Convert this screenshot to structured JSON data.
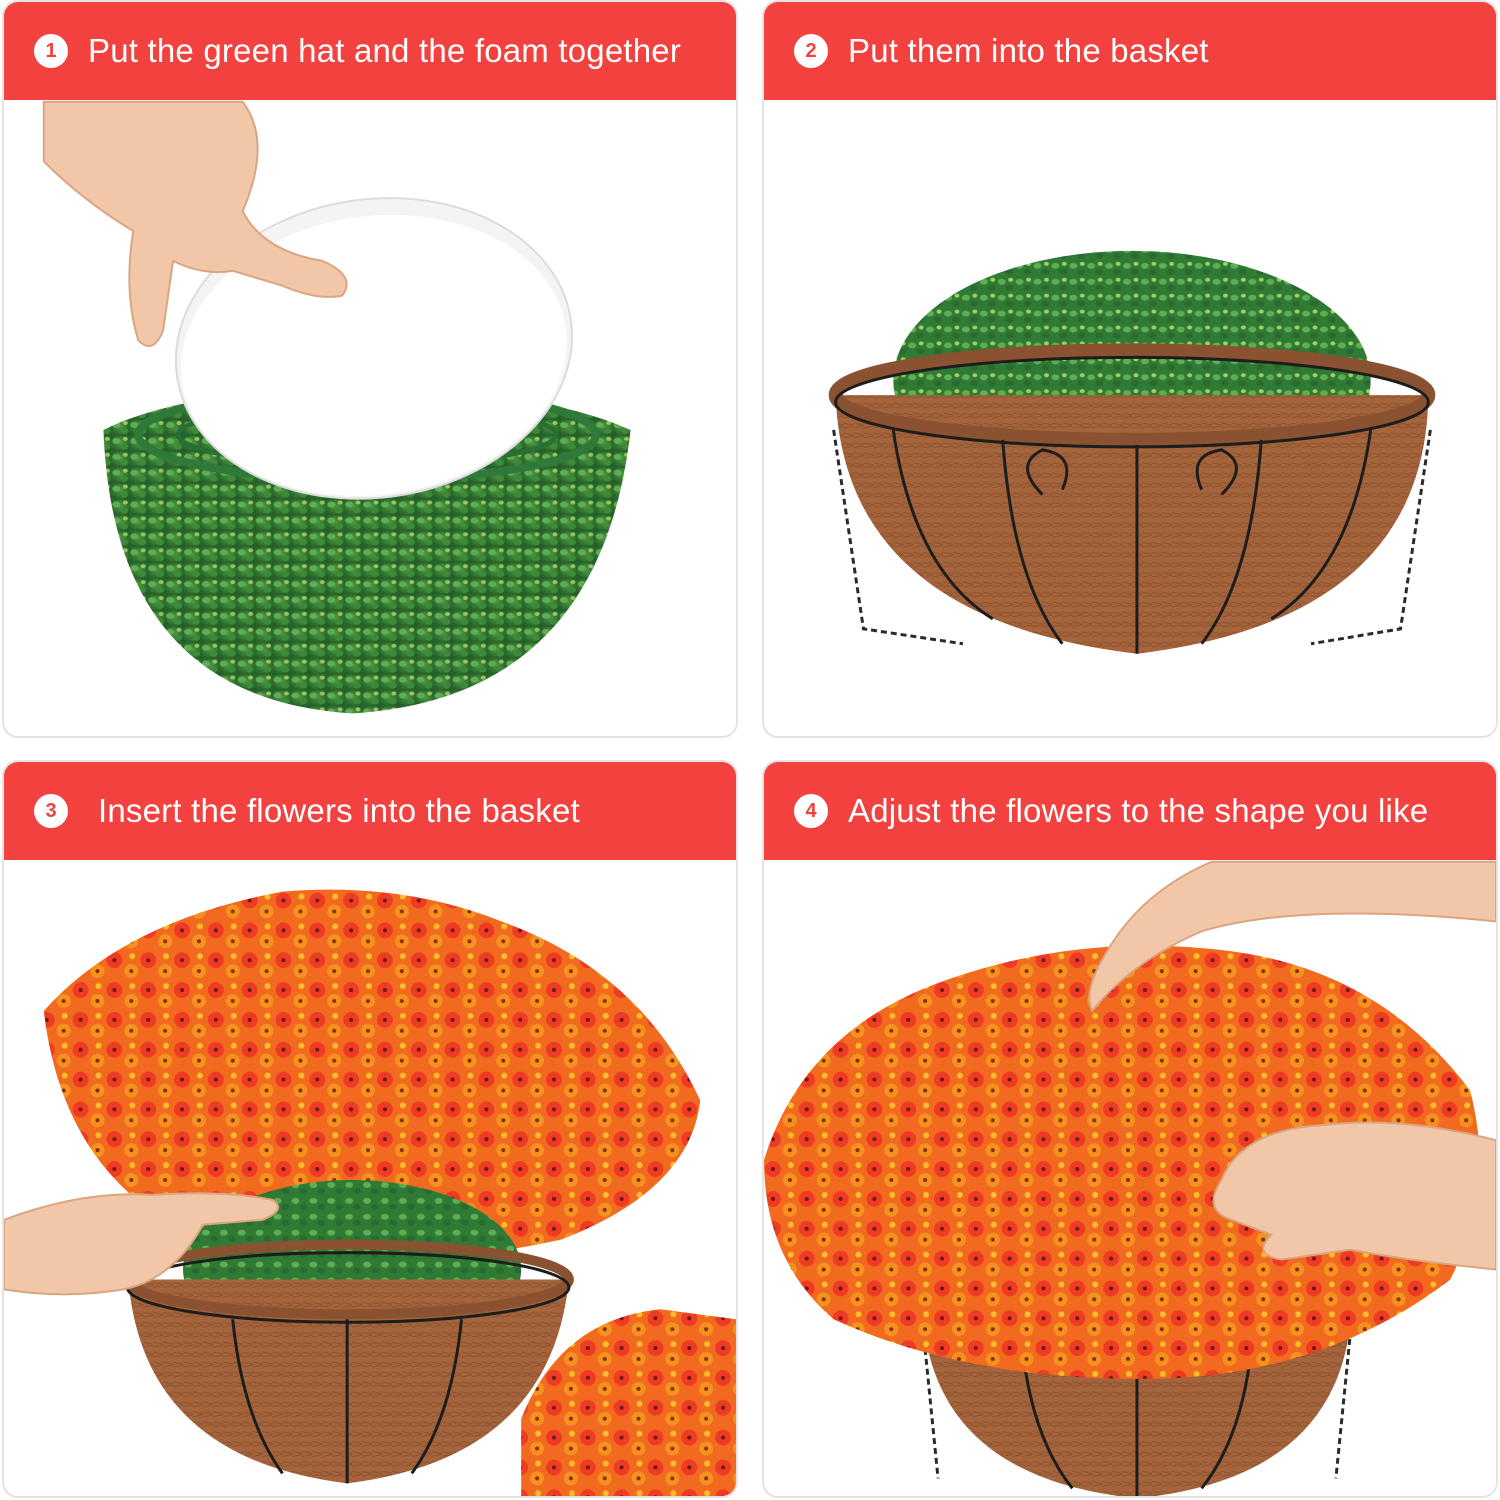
{
  "steps": [
    {
      "number": "1",
      "text": "Put the green hat and the foam together"
    },
    {
      "number": "2",
      "text": "Put them into the basket"
    },
    {
      "number": "3",
      "text": "Insert the flowers into the basket"
    },
    {
      "number": "4",
      "text": "Adjust the flowers to the shape you like"
    }
  ],
  "colors": {
    "banner": "#f2413f",
    "foliage": "#3c8a3a",
    "coir": "#a8683f",
    "frame": "#1d1d1d",
    "flower_red": "#ef3b24",
    "flower_orange": "#f5921e"
  }
}
